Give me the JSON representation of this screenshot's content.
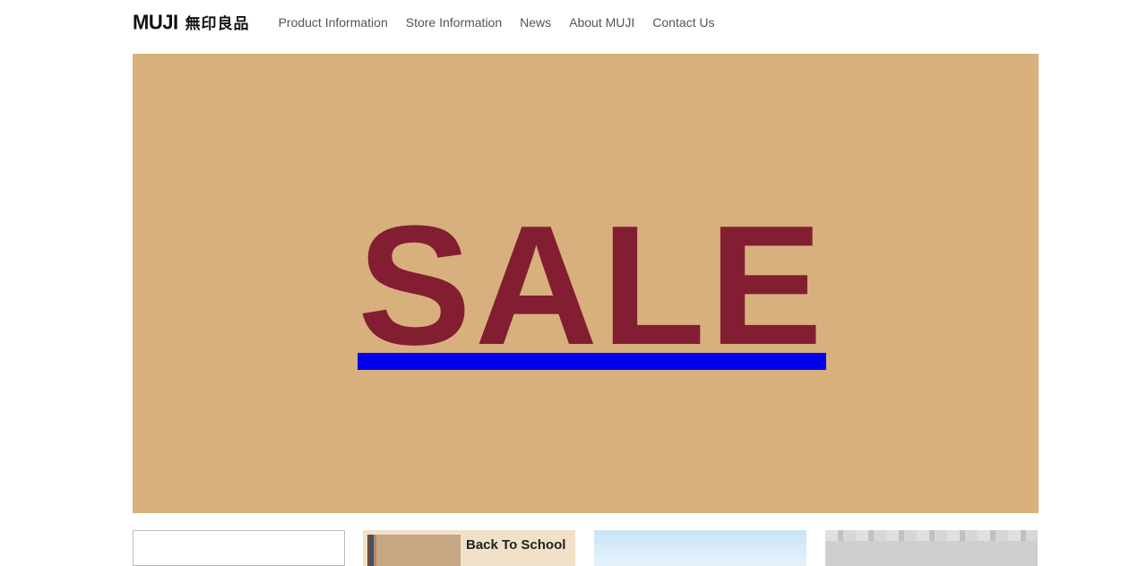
{
  "header": {
    "logo_latin": "MUJI",
    "logo_cjk": "無印良品",
    "nav": [
      {
        "label": "Product Information"
      },
      {
        "label": "Store Information"
      },
      {
        "label": "News"
      },
      {
        "label": "About MUJI"
      },
      {
        "label": "Contact Us"
      }
    ]
  },
  "hero": {
    "text": "SALE",
    "background_color": "#d8b07d",
    "text_color": "#831e32"
  },
  "tiles": [
    {
      "label": ""
    },
    {
      "label": "Back To School"
    },
    {
      "label": ""
    },
    {
      "label": ""
    }
  ]
}
